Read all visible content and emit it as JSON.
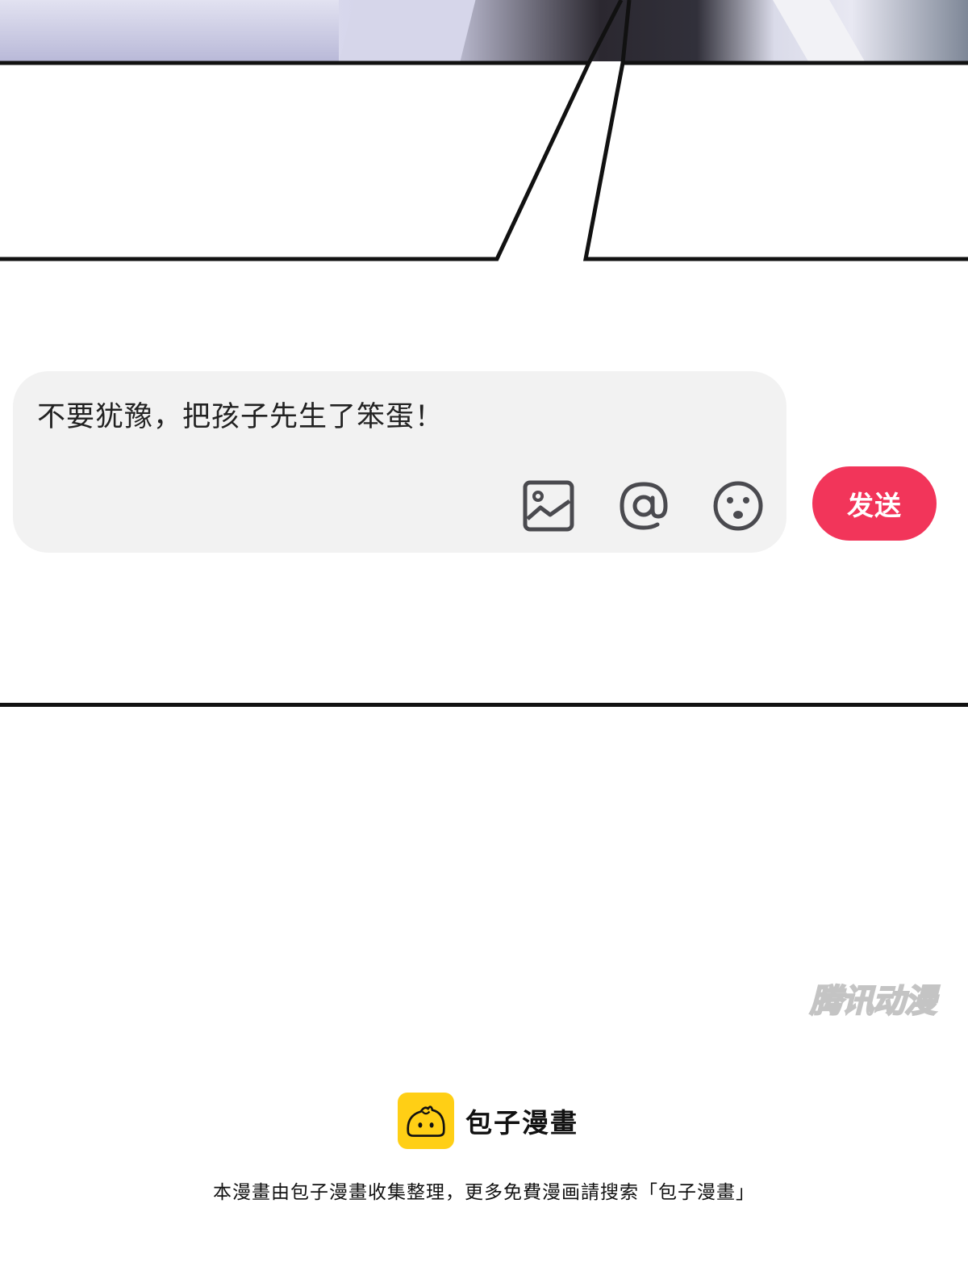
{
  "input": {
    "text": "不要犹豫，把孩子先生了笨蛋！"
  },
  "toolbar": {
    "image_icon": "image-icon",
    "mention_icon": "at-mention-icon",
    "emoji_icon": "emoji-icon"
  },
  "send_button": {
    "label": "发送",
    "color": "#f2355a"
  },
  "watermark": {
    "text": "腾讯动漫"
  },
  "brand": {
    "name": "包子漫畫",
    "logo_color": "#ffcf15"
  },
  "footer": {
    "note": "本漫畫由包子漫畫收集整理，更多免費漫画請搜索「包子漫畫」"
  }
}
